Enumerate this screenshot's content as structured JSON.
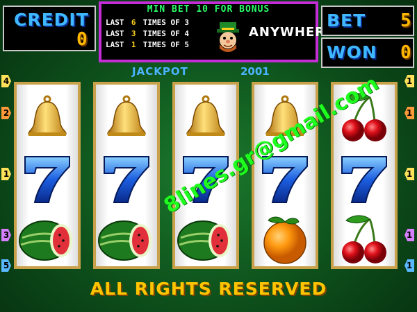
{
  "credit": {
    "label": "CREDIT",
    "value": "0"
  },
  "bet": {
    "label": "BET",
    "value": "5"
  },
  "won": {
    "label": "WON",
    "value": "0"
  },
  "bonus": {
    "title": "MIN BET 10 FOR BONUS",
    "rows": [
      {
        "prefix": "LAST",
        "num": "6",
        "suffix": "TIMES OF 3"
      },
      {
        "prefix": "LAST",
        "num": "3",
        "suffix": "TIMES OF 4"
      },
      {
        "prefix": "LAST",
        "num": "1",
        "suffix": "TIMES OF 5"
      }
    ],
    "anywhere": "ANYWHERE"
  },
  "jackpot": {
    "label": "JACKPOT",
    "value": "2001"
  },
  "reels": [
    [
      "bell-icon",
      "seven-icon",
      "watermelon-icon"
    ],
    [
      "bell-icon",
      "seven-icon",
      "watermelon-icon"
    ],
    [
      "bell-icon",
      "seven-icon",
      "watermelon-icon"
    ],
    [
      "bell-icon",
      "seven-icon",
      "orange-icon"
    ],
    [
      "cherry-icon",
      "seven-icon",
      "cherry-icon"
    ]
  ],
  "left_markers": [
    "4",
    "2",
    "1",
    "3",
    "5"
  ],
  "right_markers": [
    "1",
    "1",
    "1",
    "1",
    "1"
  ],
  "footer": "ALL RIGHTS RESERVED",
  "watermark": "8lines.gr@gmail.com",
  "colors": {
    "accent_blue": "#3fb8ff",
    "gold": "#ffb800",
    "bonus_border": "#c42cd6",
    "green_bg": "#0d4f1b"
  }
}
